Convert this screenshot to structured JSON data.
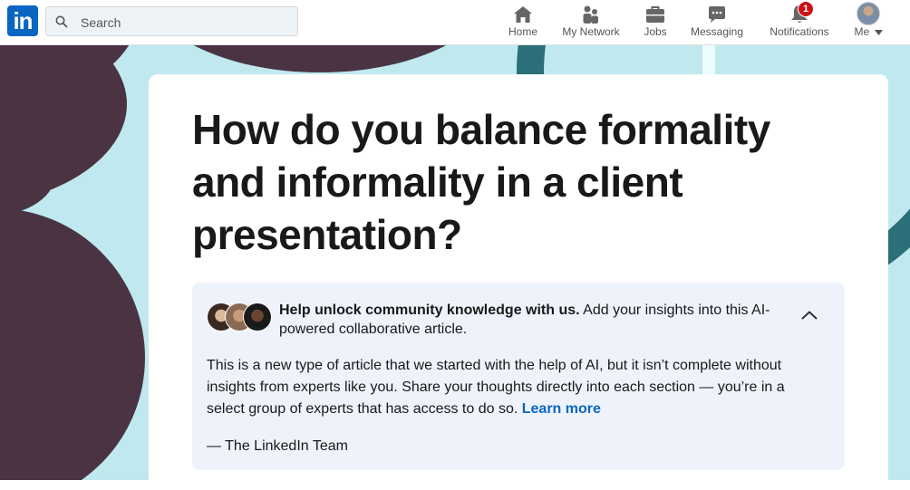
{
  "header": {
    "logo_text": "in",
    "search": {
      "placeholder": "Search"
    },
    "nav": [
      {
        "label": "Home",
        "icon": "home-icon"
      },
      {
        "label": "My Network",
        "icon": "network-icon"
      },
      {
        "label": "Jobs",
        "icon": "briefcase-icon"
      },
      {
        "label": "Messaging",
        "icon": "messaging-icon"
      },
      {
        "label": "Notifications",
        "icon": "bell-icon",
        "badge": "1"
      },
      {
        "label": "Me",
        "icon": "avatar"
      }
    ]
  },
  "article": {
    "title": "How do you balance formality and informality in a client presentation?",
    "info": {
      "help_bold": "Help unlock community knowledge with us.",
      "help_rest": " Add your insights into this AI-powered collaborative article.",
      "body": "This is a new type of article that we started with the help of AI, but it isn’t complete without insights from experts like you. Share your thoughts directly into each section — you’re in a select group of experts that has access to do so. ",
      "learn_more": "Learn more",
      "signature": "— The LinkedIn Team"
    }
  },
  "colors": {
    "brand": "#0a66c2",
    "background_teal": "#bfe9ef",
    "blob_purple": "#4a3444",
    "badge_red": "#cc1016",
    "info_bg": "#eef3fb"
  }
}
